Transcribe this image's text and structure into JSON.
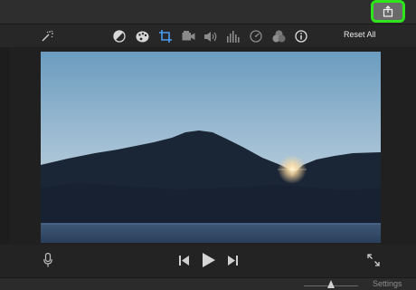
{
  "toolbar": {
    "reset_label": "Reset All",
    "icons": [
      "magic-wand-icon",
      "color-balance-icon",
      "palette-icon",
      "crop-icon",
      "camera-icon",
      "volume-icon",
      "equalizer-icon",
      "speedometer-icon",
      "filters-icon",
      "info-icon"
    ]
  },
  "share": {
    "icon": "share-icon",
    "highlight_color": "#2fe51e"
  },
  "playback": {
    "icons": [
      "microphone-icon",
      "skip-back-icon",
      "play-icon",
      "skip-forward-icon",
      "fullscreen-icon"
    ]
  },
  "footer": {
    "settings_label": "Settings"
  }
}
